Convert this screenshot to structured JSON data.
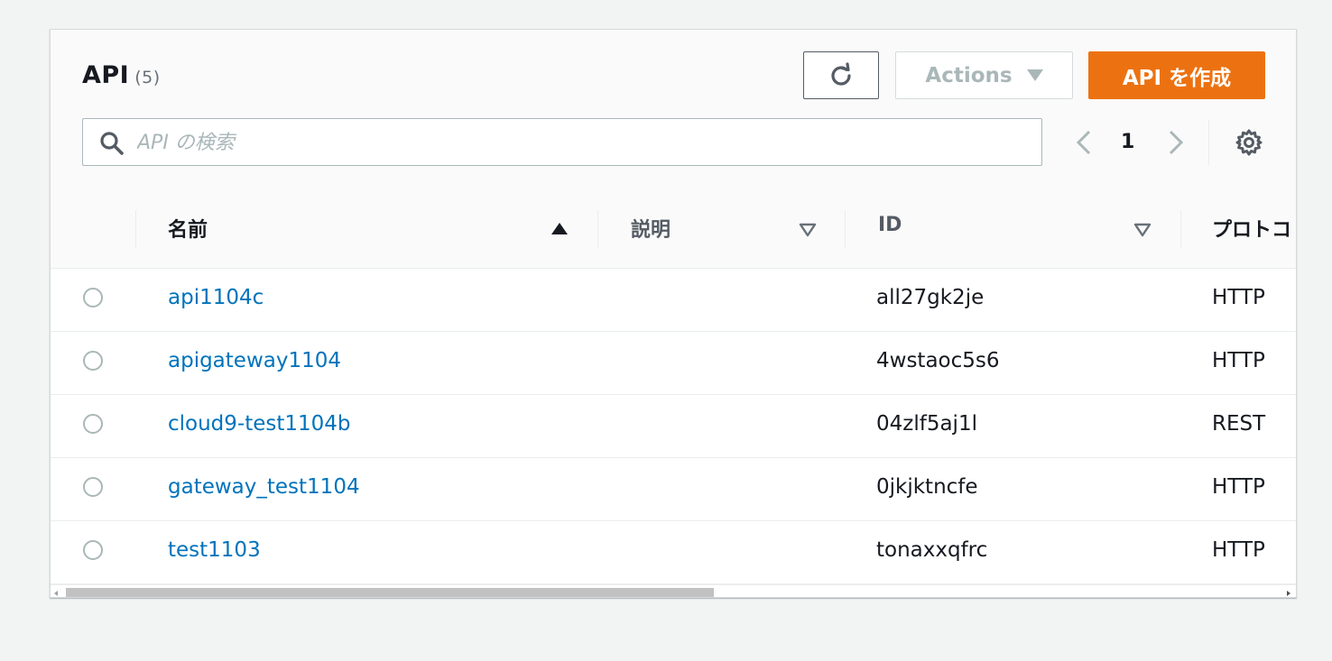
{
  "header": {
    "title": "API",
    "count": "(5)",
    "actions_label": "Actions",
    "create_label": "API を作成"
  },
  "search": {
    "placeholder": "API の検索",
    "value": ""
  },
  "pagination": {
    "current_page": "1"
  },
  "table": {
    "columns": [
      "名前",
      "説明",
      "ID",
      "プロトコ"
    ],
    "sort_column": "名前",
    "sort_direction": "ascending",
    "rows": [
      {
        "name": "api1104c",
        "description": "",
        "id": "all27gk2je",
        "protocol": "HTTP"
      },
      {
        "name": "apigateway1104",
        "description": "",
        "id": "4wstaoc5s6",
        "protocol": "HTTP"
      },
      {
        "name": "cloud9-test1104b",
        "description": "",
        "id": "04zlf5aj1l",
        "protocol": "REST"
      },
      {
        "name": "gateway_test1104",
        "description": "",
        "id": "0jkjktncfe",
        "protocol": "HTTP"
      },
      {
        "name": "test1103",
        "description": "",
        "id": "tonaxxqfrc",
        "protocol": "HTTP"
      }
    ]
  },
  "colors": {
    "primary": "#ec7211",
    "link": "#0073bb",
    "text": "#16191f",
    "muted": "#687078"
  },
  "icons": [
    "refresh-icon",
    "caret-down-icon",
    "search-icon",
    "chevron-left-icon",
    "chevron-right-icon",
    "gear-icon",
    "sort-ascending-icon",
    "sort-descending-outline-icon"
  ]
}
